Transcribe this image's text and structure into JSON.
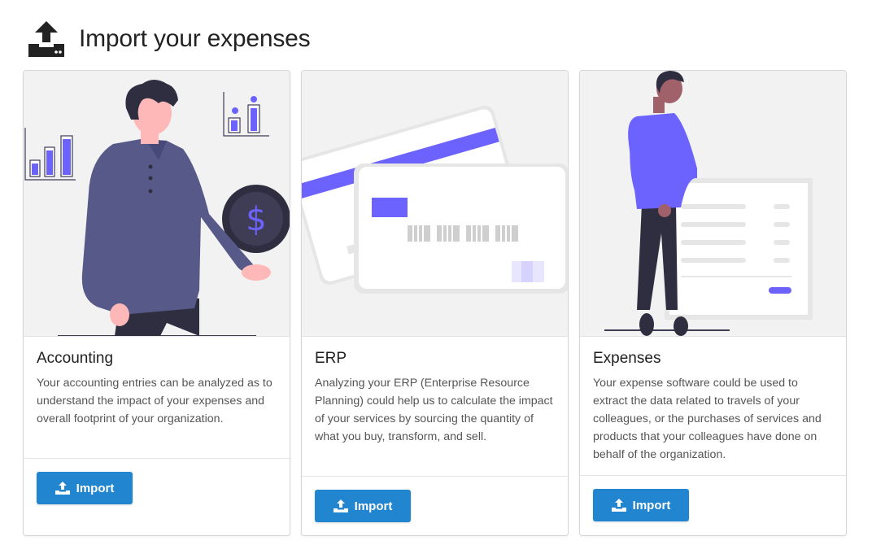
{
  "page": {
    "title": "Import your expenses",
    "title_icon": "upload-tray-icon"
  },
  "cards": [
    {
      "title": "Accounting",
      "description": "Your accounting entries can be analyzed as to understand the impact of your expenses and overall footprint of your organization.",
      "button_label": "Import",
      "button_icon": "upload-icon",
      "illustration": "person-with-dollar-coin"
    },
    {
      "title": "ERP",
      "description": "Analyzing your ERP (Enterprise Resource Planning) could help us to calculate the impact of your services by sourcing the quantity of what you buy, transform, and sell.",
      "button_label": "Import",
      "button_icon": "upload-icon",
      "illustration": "credit-cards"
    },
    {
      "title": "Expenses",
      "description": "Your expense software could be used to extract the data related to travels of your colleagues, or the purchases of services and products that your colleagues have done on behalf of the organization.",
      "button_label": "Import",
      "button_icon": "upload-icon",
      "illustration": "person-with-document"
    }
  ],
  "colors": {
    "accent": "#6c63ff",
    "button": "#2185d0",
    "dark": "#2f2e41"
  }
}
